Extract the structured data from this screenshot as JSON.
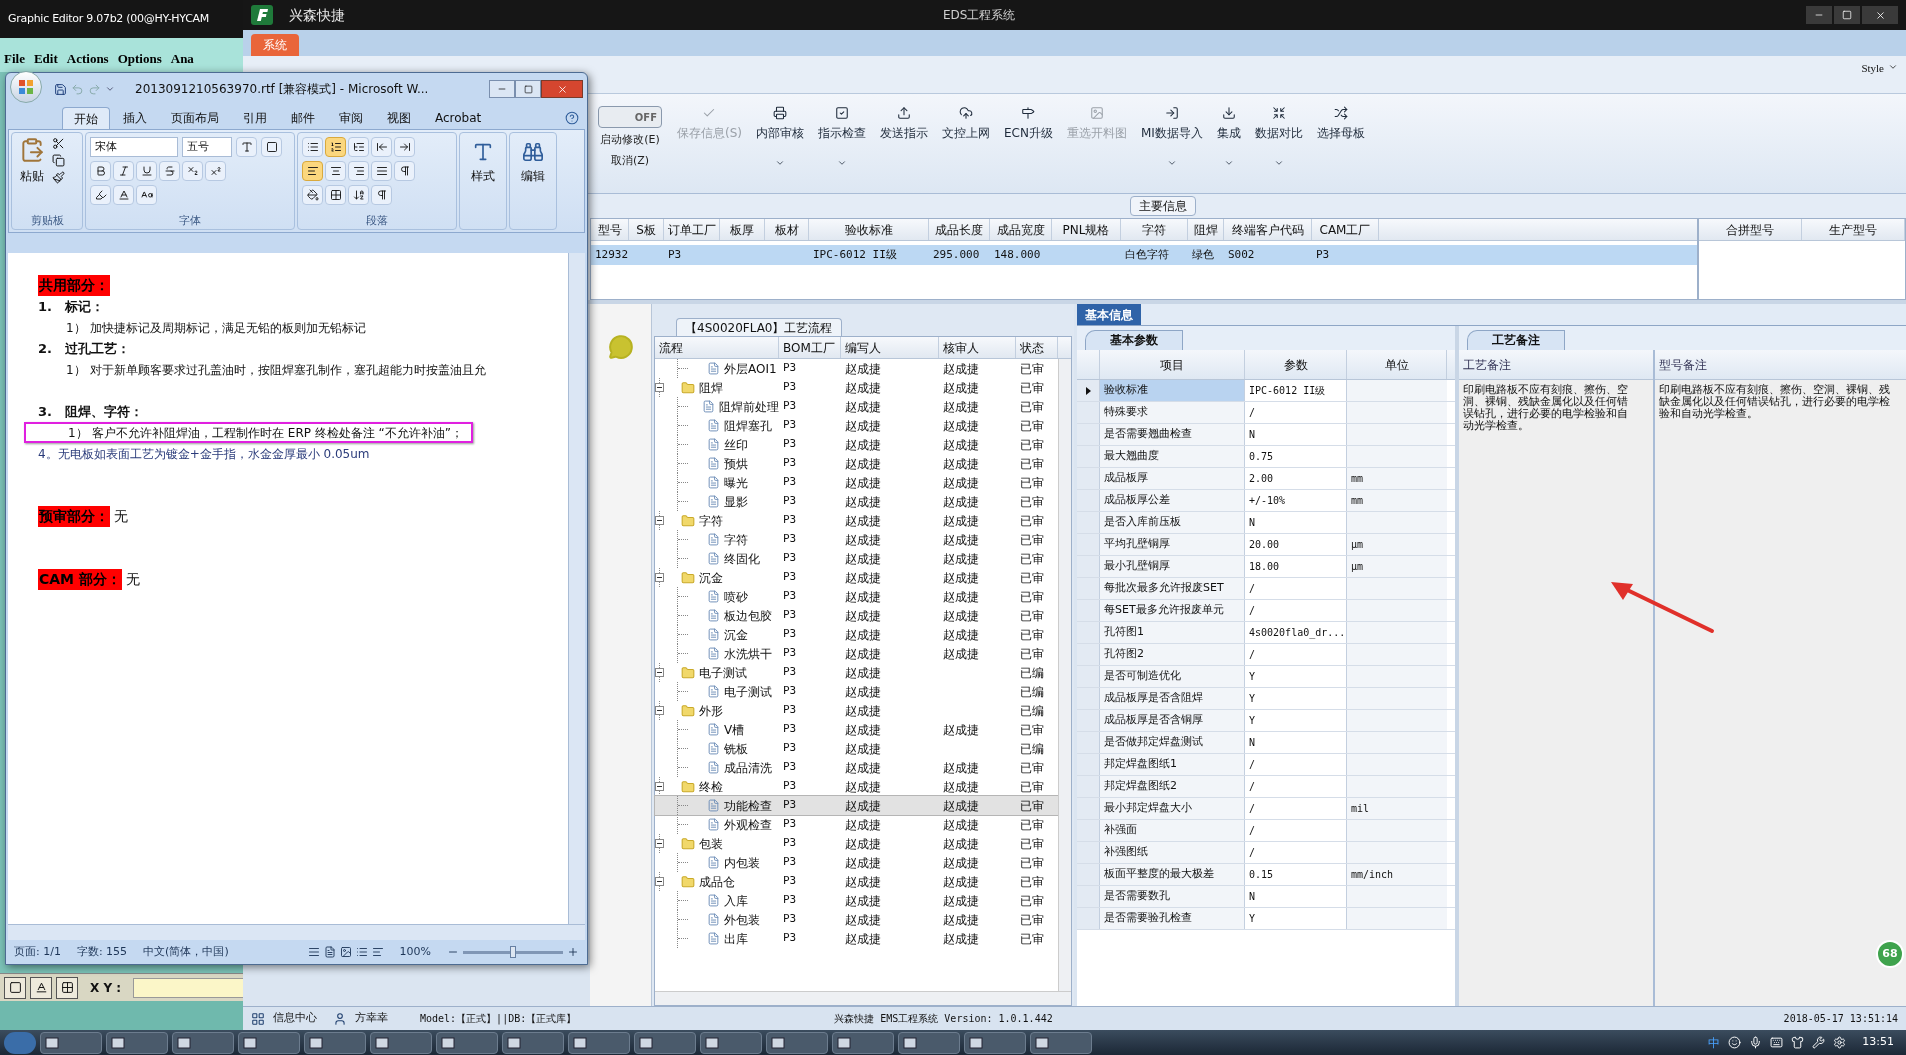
{
  "graphic_editor": {
    "title": "Graphic Editor 9.07b2 (00@HY-HYCAM",
    "menu": [
      "File",
      "Edit",
      "Actions",
      "Options",
      "Ana"
    ],
    "coord_label": "X Y :"
  },
  "ems": {
    "app_name": "兴森快捷",
    "title": "EDS工程系统",
    "tab": "系统",
    "style_label": "Style",
    "toggle": {
      "label": "OFF",
      "on": false
    },
    "toggle_actions": [
      "启动修改(E)",
      "取消(Z)"
    ],
    "toolbar": [
      {
        "label": "保存信息(S)",
        "disabled": true,
        "dropdown": false
      },
      {
        "label": "内部审核",
        "disabled": false,
        "dropdown": true
      },
      {
        "label": "指示检查",
        "disabled": false,
        "dropdown": true
      },
      {
        "label": "发送指示",
        "disabled": false,
        "dropdown": false
      },
      {
        "label": "文控上网",
        "disabled": false,
        "dropdown": false
      },
      {
        "label": "ECN升级",
        "disabled": false,
        "dropdown": false
      },
      {
        "label": "重选开料图",
        "disabled": true,
        "dropdown": false
      },
      {
        "label": "MI数据导入",
        "disabled": false,
        "dropdown": true
      },
      {
        "label": "集成",
        "disabled": false,
        "dropdown": true
      },
      {
        "label": "数据对比",
        "disabled": false,
        "dropdown": true
      },
      {
        "label": "选择母板",
        "disabled": false,
        "dropdown": false
      }
    ],
    "main_info": {
      "title": "主要信息",
      "selected": true,
      "columns": [
        {
          "title": "型号",
          "value": "12932"
        },
        {
          "title": "S板"
        },
        {
          "title": "订单工厂",
          "value": "P3"
        },
        {
          "title": "板厚"
        },
        {
          "title": "板材"
        },
        {
          "title": "验收标准",
          "value": "IPC-6012 II级"
        },
        {
          "title": "成品长度",
          "value": "295.000"
        },
        {
          "title": "成品宽度",
          "value": "148.000"
        },
        {
          "title": "PNL规格"
        },
        {
          "title": "字符",
          "value": "白色字符"
        },
        {
          "title": "阻焊",
          "value": "绿色"
        },
        {
          "title": "终端客户代码",
          "value": "S002"
        },
        {
          "title": "CAM工厂",
          "value": "P3"
        }
      ]
    },
    "side_table": {
      "columns": [
        "合拼型号",
        "生产型号"
      ]
    },
    "process": {
      "tab": "【4S0020FLA0】工艺流程",
      "columns": [
        "流程",
        "BOM工厂",
        "编写人",
        "核审人",
        "状态"
      ],
      "continued_children": [
        {
          "name": "外层AOI1",
          "factory": "P3",
          "writer": "赵成捷",
          "reviewer": "赵成捷",
          "status": "已审",
          "selected": false
        }
      ],
      "groups": [
        {
          "name": "阻焊",
          "factory": "P3",
          "writer": "赵成捷",
          "reviewer": "赵成捷",
          "status": "已审",
          "selected": false,
          "expanded": true,
          "children": [
            {
              "name": "阻焊前处理",
              "factory": "P3",
              "writer": "赵成捷",
              "reviewer": "赵成捷",
              "status": "已审",
              "selected": false
            },
            {
              "name": "阻焊塞孔",
              "factory": "P3",
              "writer": "赵成捷",
              "reviewer": "赵成捷",
              "status": "已审",
              "selected": false
            },
            {
              "name": "丝印",
              "factory": "P3",
              "writer": "赵成捷",
              "reviewer": "赵成捷",
              "status": "已审",
              "selected": false
            },
            {
              "name": "预烘",
              "factory": "P3",
              "writer": "赵成捷",
              "reviewer": "赵成捷",
              "status": "已审",
              "selected": false
            },
            {
              "name": "曝光",
              "factory": "P3",
              "writer": "赵成捷",
              "reviewer": "赵成捷",
              "status": "已审",
              "selected": false
            },
            {
              "name": "显影",
              "factory": "P3",
              "writer": "赵成捷",
              "reviewer": "赵成捷",
              "status": "已审",
              "selected": false
            }
          ]
        },
        {
          "name": "字符",
          "factory": "P3",
          "writer": "赵成捷",
          "reviewer": "赵成捷",
          "status": "已审",
          "selected": false,
          "expanded": true,
          "children": [
            {
              "name": "字符",
              "factory": "P3",
              "writer": "赵成捷",
              "reviewer": "赵成捷",
              "status": "已审",
              "selected": false
            },
            {
              "name": "终固化",
              "factory": "P3",
              "writer": "赵成捷",
              "reviewer": "赵成捷",
              "status": "已审",
              "selected": false
            }
          ]
        },
        {
          "name": "沉金",
          "factory": "P3",
          "writer": "赵成捷",
          "reviewer": "赵成捷",
          "status": "已审",
          "selected": false,
          "expanded": true,
          "children": [
            {
              "name": "喷砂",
              "factory": "P3",
              "writer": "赵成捷",
              "reviewer": "赵成捷",
              "status": "已审",
              "selected": false
            },
            {
              "name": "板边包胶",
              "factory": "P3",
              "writer": "赵成捷",
              "reviewer": "赵成捷",
              "status": "已审",
              "selected": false
            },
            {
              "name": "沉金",
              "factory": "P3",
              "writer": "赵成捷",
              "reviewer": "赵成捷",
              "status": "已审",
              "selected": false
            },
            {
              "name": "水洗烘干",
              "factory": "P3",
              "writer": "赵成捷",
              "reviewer": "赵成捷",
              "status": "已审",
              "selected": false
            }
          ]
        },
        {
          "name": "电子测试",
          "factory": "P3",
          "writer": "赵成捷",
          "status": "已编",
          "selected": false,
          "expanded": true,
          "children": [
            {
              "name": "电子测试",
              "factory": "P3",
              "writer": "赵成捷",
              "status": "已编",
              "selected": false
            }
          ]
        },
        {
          "name": "外形",
          "factory": "P3",
          "writer": "赵成捷",
          "status": "已编",
          "selected": false,
          "expanded": true,
          "children": [
            {
              "name": "V槽",
              "factory": "P3",
              "writer": "赵成捷",
              "reviewer": "赵成捷",
              "status": "已审",
              "selected": false
            },
            {
              "name": "铣板",
              "factory": "P3",
              "writer": "赵成捷",
              "status": "已编",
              "selected": false
            },
            {
              "name": "成品清洗",
              "factory": "P3",
              "writer": "赵成捷",
              "reviewer": "赵成捷",
              "status": "已审",
              "selected": false
            }
          ]
        },
        {
          "name": "终检",
          "factory": "P3",
          "writer": "赵成捷",
          "reviewer": "赵成捷",
          "status": "已审",
          "selected": false,
          "expanded": true,
          "children": [
            {
              "name": "功能检查",
              "factory": "P3",
              "writer": "赵成捷",
              "reviewer": "赵成捷",
              "status": "已审",
              "selected": true
            },
            {
              "name": "外观检查",
              "factory": "P3",
              "writer": "赵成捷",
              "reviewer": "赵成捷",
              "status": "已审",
              "selected": false
            }
          ]
        },
        {
          "name": "包装",
          "factory": "P3",
          "writer": "赵成捷",
          "reviewer": "赵成捷",
          "status": "已审",
          "selected": false,
          "expanded": true,
          "children": [
            {
              "name": "内包装",
              "factory": "P3",
              "writer": "赵成捷",
              "reviewer": "赵成捷",
              "status": "已审",
              "selected": false
            }
          ]
        },
        {
          "name": "成品仓",
          "factory": "P3",
          "writer": "赵成捷",
          "reviewer": "赵成捷",
          "status": "已审",
          "selected": false,
          "expanded": true,
          "children": [
            {
              "name": "入库",
              "factory": "P3",
              "writer": "赵成捷",
              "reviewer": "赵成捷",
              "status": "已审",
              "selected": false
            },
            {
              "name": "外包装",
              "factory": "P3",
              "writer": "赵成捷",
              "reviewer": "赵成捷",
              "status": "已审",
              "selected": false
            },
            {
              "name": "出库",
              "factory": "P3",
              "writer": "赵成捷",
              "reviewer": "赵成捷",
              "status": "已审",
              "selected": false
            }
          ]
        }
      ]
    },
    "basic_info": {
      "tab": "基本信息",
      "sub_tab": "基本参数",
      "columns": [
        "项目",
        "参数",
        "单位"
      ],
      "rows": [
        {
          "item": "验收标准",
          "value": "IPC-6012 II级",
          "selected": true
        },
        {
          "item": "特殊要求",
          "value": "/",
          "selected": false
        },
        {
          "item": "是否需要翘曲检查",
          "value": "N",
          "selected": false
        },
        {
          "item": "最大翘曲度",
          "value": "0.75",
          "selected": false
        },
        {
          "item": "成品板厚",
          "value": "2.00",
          "unit": "mm",
          "selected": false
        },
        {
          "item": "成品板厚公差",
          "value": "+/-10%",
          "unit": "mm",
          "selected": false
        },
        {
          "item": "是否入库前压板",
          "value": "N",
          "selected": false
        },
        {
          "item": "平均孔壁铜厚",
          "value": "20.00",
          "unit": "μm",
          "selected": false
        },
        {
          "item": "最小孔壁铜厚",
          "value": "18.00",
          "unit": "μm",
          "selected": false
        },
        {
          "item": "每批次最多允许报废SET",
          "value": "/",
          "selected": false
        },
        {
          "item": "每SET最多允许报废单元",
          "value": "/",
          "selected": false
        },
        {
          "item": "孔符图1",
          "value": "4s0020fla0_dr...",
          "selected": false
        },
        {
          "item": "孔符图2",
          "value": "/",
          "selected": false
        },
        {
          "item": "是否可制造优化",
          "value": "Y",
          "selected": false
        },
        {
          "item": "成品板厚是否含阻焊",
          "value": "Y",
          "selected": false
        },
        {
          "item": "成品板厚是否含铜厚",
          "value": "Y",
          "selected": false
        },
        {
          "item": "是否做邦定焊盘测试",
          "value": "N",
          "selected": false
        },
        {
          "item": "邦定焊盘图纸1",
          "value": "/",
          "selected": false
        },
        {
          "item": "邦定焊盘图纸2",
          "value": "/",
          "selected": false
        },
        {
          "item": "最小邦定焊盘大小",
          "value": "/",
          "unit": "mil",
          "selected": false
        },
        {
          "item": "补强面",
          "value": "/",
          "selected": false
        },
        {
          "item": "补强图纸",
          "value": "/",
          "selected": false
        },
        {
          "item": "板面平整度的最大极差",
          "value": "0.15",
          "unit": "mm/inch",
          "selected": false
        },
        {
          "item": "是否需要数孔",
          "value": "N",
          "selected": false
        },
        {
          "item": "是否需要验孔检查",
          "value": "Y",
          "selected": false
        }
      ]
    },
    "remarks": {
      "tab": "工艺备注",
      "columns": [
        {
          "title": "工艺备注",
          "text": "印刷电路板不应有刻痕、擦伤、空洞、裸铜、残缺金属化以及任何错误钻孔，进行必要的电学检验和自动光学检查。"
        },
        {
          "title": "型号备注",
          "text": "印刷电路板不应有刻痕、擦伤、空洞、裸铜、残缺金属化以及任何错误钻孔，进行必要的电学检验和自动光学检查。"
        }
      ]
    },
    "status_bar": {
      "info_center": "信息中心",
      "user": "方幸幸",
      "model": "Model:【正式】||DB:【正式库】",
      "version": "兴森快捷 EMS工程系统 Version: 1.0.1.442",
      "timestamp": "2018-05-17 13:51:14"
    }
  },
  "word": {
    "title": "2013091210563970.rtf [兼容模式] - Microsoft W...",
    "tabs": [
      {
        "label": "开始",
        "selected": true
      },
      {
        "label": "插入",
        "selected": false
      },
      {
        "label": "页面布局",
        "selected": false
      },
      {
        "label": "引用",
        "selected": false
      },
      {
        "label": "邮件",
        "selected": false
      },
      {
        "label": "审阅",
        "selected": false
      },
      {
        "label": "视图",
        "selected": false
      },
      {
        "label": "Acrobat",
        "selected": false
      }
    ],
    "paste_label": "粘贴",
    "font": "宋体",
    "font_size": "五号",
    "groups": [
      "剪贴板",
      "字体",
      "段落"
    ],
    "styles_label": "样式",
    "edit_label": "编辑",
    "lines": [
      {
        "kind": "section",
        "label": "共用部分："
      },
      {
        "kind": "heading",
        "number": "1.",
        "text": "标记："
      },
      {
        "kind": "item",
        "number": "1）",
        "text": "加快捷标记及周期标记，满足无铅的板则加无铅标记",
        "boxed": false
      },
      {
        "kind": "heading",
        "number": "2.",
        "text": "过孔工艺："
      },
      {
        "kind": "item",
        "number": "1）",
        "text": "对于新单顾客要求过孔盖油时，按阻焊塞孔制作，塞孔超能力时按盖油且允",
        "boxed": false
      },
      {
        "kind": "blank"
      },
      {
        "kind": "heading",
        "number": "3.",
        "text": "阻焊、字符："
      },
      {
        "kind": "item",
        "number": "1）",
        "text": "客户不允许补阻焊油，工程制作时在 ERP 终检处备注 “不允许补油”；",
        "boxed": true
      },
      {
        "kind": "plain",
        "text": "4。无电板如表面工艺为镀金+金手指，水金金厚最小 0.05um"
      },
      {
        "kind": "blank"
      },
      {
        "kind": "blank"
      },
      {
        "kind": "section",
        "label": "预审部分：",
        "suffix": "无"
      },
      {
        "kind": "blank"
      },
      {
        "kind": "blank"
      },
      {
        "kind": "section",
        "label": "CAM 部分：",
        "suffix": "无"
      }
    ],
    "status": [
      "页面: 1/1",
      "字数: 155",
      "中文(简体，中国)"
    ],
    "zoom": "100%",
    "zoom_slider": {
      "level": 0.5
    }
  },
  "badge": "68",
  "taskbar": {
    "ime": "中",
    "clock": "13:51"
  }
}
